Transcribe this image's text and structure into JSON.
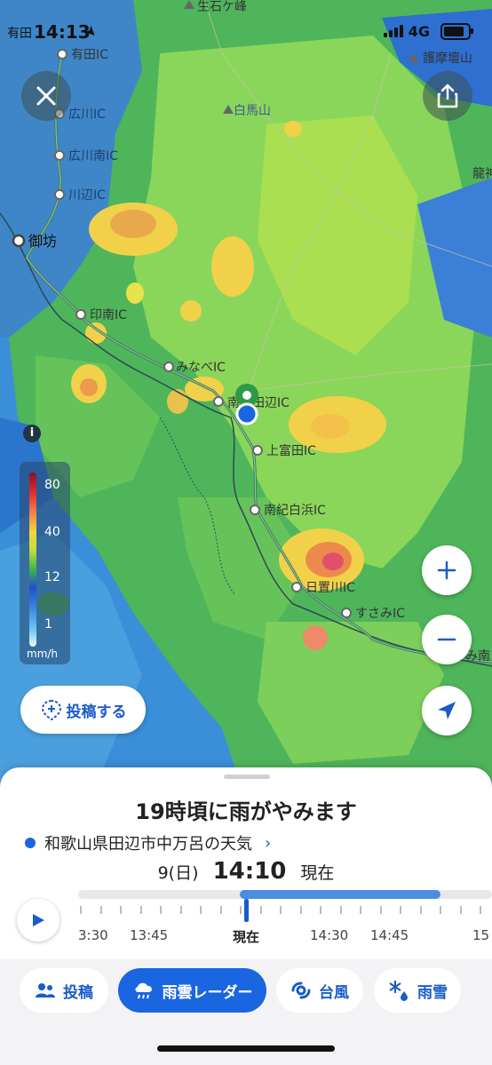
{
  "status_bar": {
    "time": "14:13",
    "carrier_left": "有田",
    "network": "4G"
  },
  "map": {
    "labels": [
      {
        "id": "arida-ic",
        "text": "有田IC",
        "kind": "ic"
      },
      {
        "id": "hirokawa-ic",
        "text": "広川IC",
        "kind": "ic"
      },
      {
        "id": "hirokawa-minami-ic",
        "text": "広川南IC",
        "kind": "ic"
      },
      {
        "id": "kawabe-ic",
        "text": "川辺IC",
        "kind": "ic"
      },
      {
        "id": "gobo",
        "text": "御坊",
        "kind": "city"
      },
      {
        "id": "inami-ic",
        "text": "印南IC",
        "kind": "ic"
      },
      {
        "id": "minabe-ic",
        "text": "みなべIC",
        "kind": "ic"
      },
      {
        "id": "nanki-tanabe-ic",
        "text": "南紀田辺IC",
        "kind": "ic"
      },
      {
        "id": "kamitonda-ic",
        "text": "上富田IC",
        "kind": "ic"
      },
      {
        "id": "nanki-shirahama-ic",
        "text": "南紀白浜IC",
        "kind": "ic"
      },
      {
        "id": "hikigawa-ic",
        "text": "日置川IC",
        "kind": "ic"
      },
      {
        "id": "susami-ic",
        "text": "すさみIC",
        "kind": "ic"
      },
      {
        "id": "shiraumasan",
        "text": "白馬山",
        "kind": "peak"
      },
      {
        "id": "ikuishigamine",
        "text": "生石ケ峰",
        "kind": "peak"
      },
      {
        "id": "gomadanzan",
        "text": "護摩壇山",
        "kind": "peak"
      },
      {
        "id": "ryujin",
        "text": "龍神",
        "kind": "town"
      },
      {
        "id": "susami-minami",
        "text": "み南",
        "kind": "town"
      }
    ]
  },
  "legend": {
    "ticks": [
      "80",
      "40",
      "12",
      "1"
    ],
    "unit": "mm/h"
  },
  "buttons": {
    "post": "投稿する"
  },
  "sheet": {
    "headline": "19時頃に雨がやみます",
    "location": "和歌山県田辺市中万呂の天気",
    "date": "9(日)",
    "time": "14:10",
    "now_label": "現在",
    "timeline_labels": [
      "3:30",
      "13:45",
      "現在",
      "14:30",
      "14:45",
      "15"
    ]
  },
  "tabs": [
    {
      "label": "投稿",
      "icon": "people-icon",
      "active": false
    },
    {
      "label": "雨雲レーダー",
      "icon": "rain-cloud-icon",
      "active": true
    },
    {
      "label": "台風",
      "icon": "typhoon-icon",
      "active": false
    },
    {
      "label": "雨雪",
      "icon": "snow-icon",
      "active": false
    }
  ],
  "colors": {
    "accent": "#1a5cc8",
    "active_tab": "#1a66e0"
  }
}
